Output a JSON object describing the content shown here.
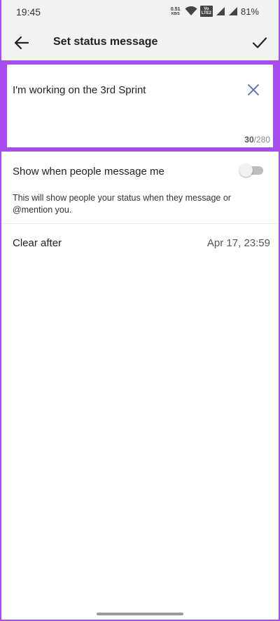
{
  "status_bar": {
    "time": "19:45",
    "net_speed_value": "0.51",
    "net_speed_unit": "KB/S",
    "volte_top": "Vo",
    "volte_bottom": "LTE2",
    "battery": "81%"
  },
  "header": {
    "title": "Set status message",
    "back_icon": "arrow-left-icon",
    "confirm_icon": "check-icon"
  },
  "status_input": {
    "value": "I'm working on the 3rd Sprint",
    "char_count": "30",
    "char_limit": "/280",
    "clear_icon": "close-icon"
  },
  "settings": {
    "show_when_messaged": {
      "label": "Show when people message me",
      "enabled": false,
      "description": "This will show people your status when they message or @mention you."
    },
    "clear_after": {
      "label": "Clear after",
      "value": "Apr 17, 23:59"
    }
  },
  "colors": {
    "highlight": "#a94df0",
    "background": "#f3f2f3",
    "surface": "#ffffff"
  }
}
